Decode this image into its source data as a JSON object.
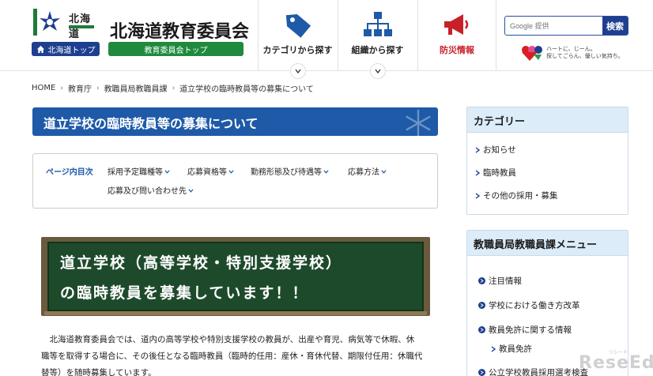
{
  "header": {
    "pref_name": "北海道",
    "hokkaido_top_label": "北海道トップ",
    "board_title": "北海道教育委員会",
    "board_top_label": "教育委員会トップ",
    "nav": [
      {
        "label": "カテゴリから探す",
        "icon": "tag-icon"
      },
      {
        "label": "組織から探す",
        "icon": "org-chart-icon"
      },
      {
        "label": "防災情報",
        "icon": "megaphone-icon"
      }
    ],
    "search": {
      "placeholder": "Google 提供",
      "button_label": "検索"
    },
    "heart_text_line1": "ハートに、じーん。",
    "heart_text_line2": "探してごらん、優しい気持ち。"
  },
  "breadcrumb": [
    "HOME",
    "教育庁",
    "教職員局教職員課",
    "道立学校の臨時教員等の募集について"
  ],
  "page": {
    "title": "道立学校の臨時教員等の募集について",
    "toc_head": "ページ内目次",
    "toc_links": [
      "採用予定職種等",
      "応募資格等",
      "勤務形態及び待遇等",
      "応募方法",
      "応募及び問い合わせ先"
    ],
    "banner_line1": "道立学校（高等学校・特別支援学校）",
    "banner_line2": "の臨時教員を募集しています！！",
    "body_line1": "　北海道教育委員会では、道内の高等学校や特別支援学校の教員が、出産や育児、病気等で休暇、休",
    "body_line2": "職等を取得する場合に、その後任となる臨時教員（臨時的任用：産休・育休代替、期限付任用：休職代",
    "body_line3": "替等）を随時募集しています。"
  },
  "sidebar": {
    "category_head": "カテゴリー",
    "category_items": [
      "お知らせ",
      "臨時教員",
      "その他の採用・募集"
    ],
    "menu_head": "教職員局教職員課メニュー",
    "menu_items": [
      "注目情報",
      "学校における働き方改革",
      "教員免許に関する情報"
    ],
    "menu_sub_items": [
      "教員免許"
    ],
    "menu_partial": "公立学校教員採用選考検査"
  },
  "watermark": {
    "text": "ReseEd",
    "small": "リシード"
  },
  "colors": {
    "primary_blue": "#1e5aa8",
    "dark_blue": "#1e3f8f",
    "green": "#1f8a3d",
    "alert_red": "#c8202a",
    "blackboard": "#1e4a2c"
  }
}
